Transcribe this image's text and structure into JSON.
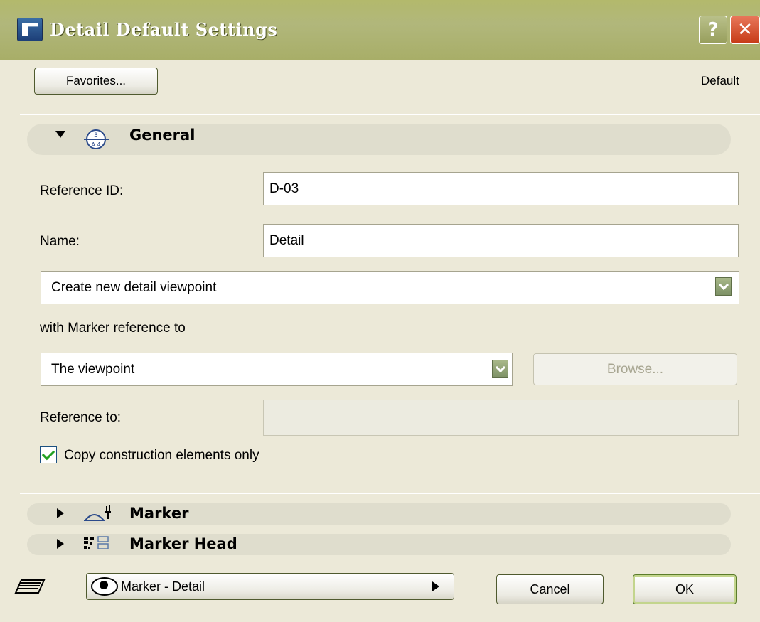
{
  "window": {
    "title": "Detail Default Settings",
    "help_glyph": "?",
    "close_glyph": "✕"
  },
  "toolbar": {
    "favorites_label": "Favorites...",
    "preset_label": "Default"
  },
  "sections": {
    "general": "General",
    "marker": "Marker",
    "marker_head": "Marker Head"
  },
  "form": {
    "reference_id_label": "Reference ID:",
    "reference_id_value": "D-03",
    "name_label": "Name:",
    "name_value": "Detail",
    "create_mode": "Create new detail viewpoint",
    "marker_ref_label": "with Marker reference to",
    "marker_ref_value": "The viewpoint",
    "browse_label": "Browse...",
    "reference_to_label": "Reference to:",
    "reference_to_value": "",
    "copy_only_label": "Copy construction elements only",
    "copy_only_checked": true
  },
  "footer": {
    "layer_value": "Marker - Detail",
    "cancel_label": "Cancel",
    "ok_label": "OK"
  },
  "colors": {
    "titlebar": "#b1b77b",
    "dialog_bg": "#ece9d8",
    "close_red": "#c63a16",
    "accent_green": "#7d9166"
  }
}
